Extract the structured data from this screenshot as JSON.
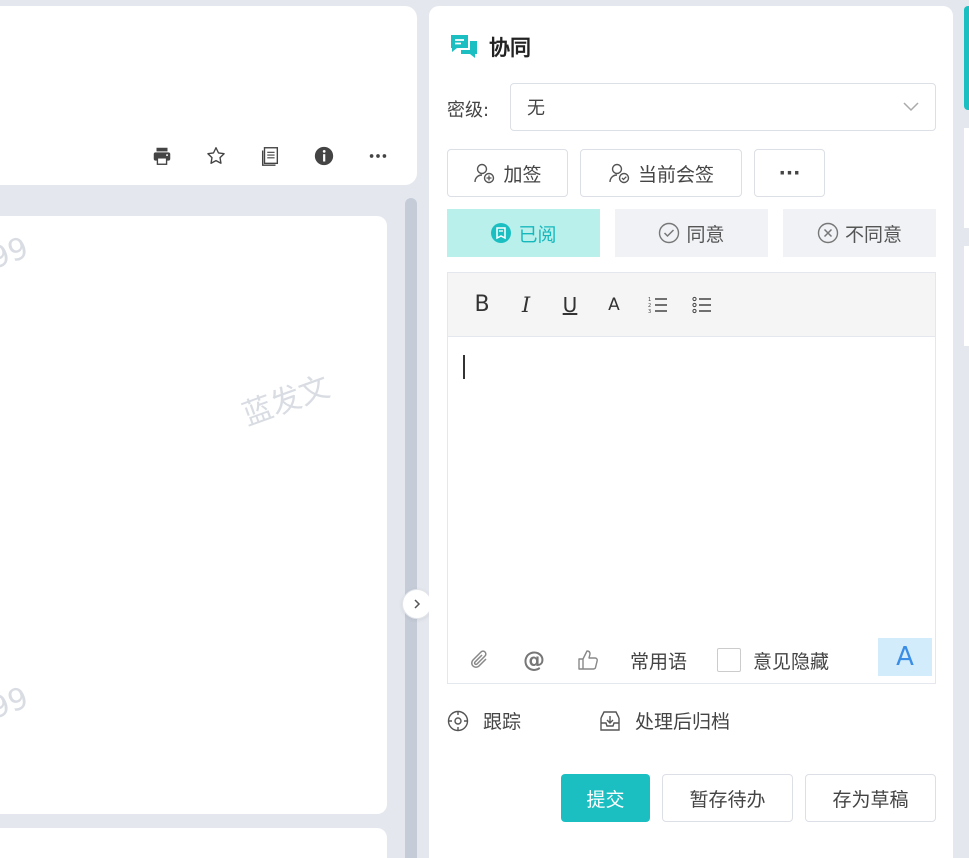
{
  "document": {
    "watermark": "蓝发文",
    "watermark_num": "99"
  },
  "toolbar": {
    "icons": [
      "print-icon",
      "star-icon",
      "copy-icon",
      "info-icon",
      "more-icon"
    ]
  },
  "panel": {
    "title": "协同",
    "level_label": "密级:",
    "level_value": "无",
    "buttons": {
      "add_sign": "加签",
      "current_sign": "当前会签",
      "more": "···"
    },
    "opinions": [
      {
        "label": "已阅",
        "active": true
      },
      {
        "label": "同意",
        "active": false
      },
      {
        "label": "不同意",
        "active": false
      }
    ],
    "editor": {
      "tools": [
        "B",
        "I",
        "U",
        "A"
      ],
      "common_phrases": "常用语",
      "hide_opinion": "意见隐藏",
      "font_button": "A"
    },
    "track": "跟踪",
    "archive": "处理后归档",
    "actions": {
      "submit": "提交",
      "save_pending": "暂存待办",
      "save_draft": "存为草稿"
    }
  },
  "colors": {
    "accent": "#1bbfc1",
    "active_bg": "#b9f0ec"
  }
}
